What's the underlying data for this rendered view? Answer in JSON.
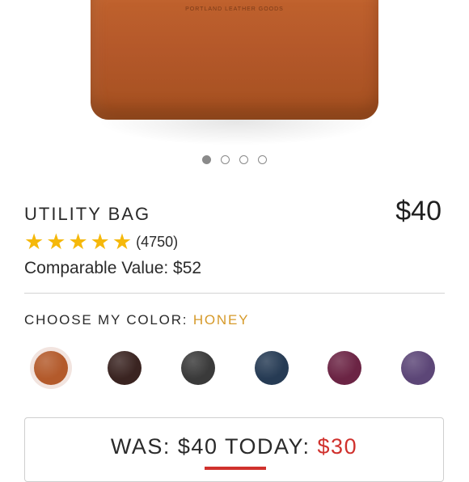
{
  "product": {
    "bag_stamp": "PORTLAND LEATHER GOODS",
    "carousel_dots": [
      true,
      false,
      false,
      false
    ],
    "name": "UTILITY BAG",
    "price": "$40",
    "rating_stars": 5,
    "review_count": "(4750)",
    "comparable_value": "Comparable Value: $52"
  },
  "color_picker": {
    "label": "CHOOSE MY COLOR:",
    "selected": "HONEY",
    "swatches": [
      {
        "name": "honey",
        "color": "#b35a2b"
      },
      {
        "name": "espresso",
        "color": "#3a2421"
      },
      {
        "name": "black",
        "color": "#3a3a3a"
      },
      {
        "name": "navy",
        "color": "#263b54"
      },
      {
        "name": "plum",
        "color": "#6b2444"
      },
      {
        "name": "purple",
        "color": "#5c4677"
      }
    ]
  },
  "promo": {
    "was_label": "WAS: $40",
    "today_label": "TODAY:",
    "today_price": "$30"
  },
  "colors": {
    "star": "#f5b80a",
    "accent_gold": "#d69a2a",
    "sale_red": "#d0312d"
  }
}
